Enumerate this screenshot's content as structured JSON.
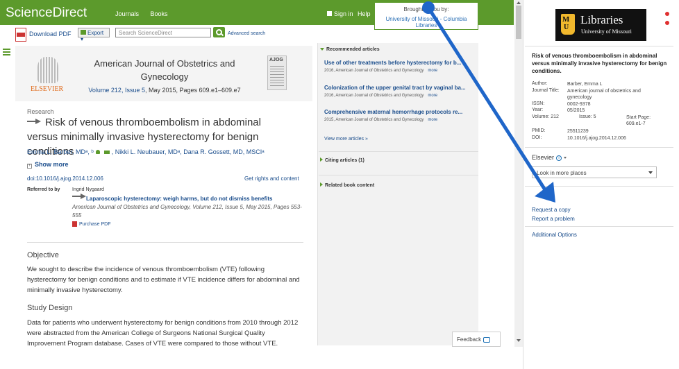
{
  "header": {
    "logo": "ScienceDirect",
    "nav": [
      "Journals",
      "Books"
    ],
    "sign_in": "Sign in",
    "help": "Help",
    "brought_by": "Brought to you by:",
    "institution": "University of Missouri - Columbia Libraries"
  },
  "toolbar": {
    "download_pdf": "Download PDF",
    "export": "Export",
    "search_placeholder": "Search ScienceDirect",
    "advanced_search": "Advanced search"
  },
  "article": {
    "publisher": "ELSEVIER",
    "journal": "American Journal of Obstetrics and Gynecology",
    "volume_link": "Volume 212, Issue 5",
    "volume_rest": ", May 2015, Pages 609.e1–609.e7",
    "cover_label": "AJOG",
    "section": "Research",
    "title": "Risk of venous thromboembolism in abdominal versus minimally invasive hysterectomy for benign conditions",
    "authors": [
      "Emma L. Barber, MDᵃ, ᵇ",
      "Nikki L. Neubauer, MDᵃ",
      "Dana R. Gossett, MD, MSCIᵃ"
    ],
    "show_more": "Show more",
    "doi": "doi:10.1016/j.ajog.2014.12.006",
    "rights": "Get rights and content",
    "referred_label": "Referred to by",
    "referred_name": "Ingrid Nygaard",
    "referred_title": "Laparoscopic hysterectomy: weigh harms, but do not dismiss benefits",
    "referred_cite": "American Journal of Obstetrics and Gynecology, Volume 212, Issue 5, May 2015, Pages 553-555",
    "purchase_pdf": "Purchase PDF",
    "objective_heading": "Objective",
    "objective_text": "We sought to describe the incidence of venous thromboembolism (VTE) following hysterectomy for benign conditions and to estimate if VTE incidence differs for abdominal and minimally invasive hysterectomy.",
    "study_heading": "Study Design",
    "study_text": "Data for patients who underwent hysterectomy for benign conditions from 2010 through 2012 were abstracted from the American College of Surgeons National Surgical Quality Improvement Program database. Cases of VTE were compared to those without VTE."
  },
  "sidebar_middle": {
    "recommended_heading": "Recommended articles",
    "recommended": [
      {
        "title": "Use of other treatments before hysterectomy for b...",
        "meta": "2016, American Journal of Obstetrics and Gynecology",
        "more": "more"
      },
      {
        "title": "Colonization of the upper genital tract by vaginal ba...",
        "meta": "2016, American Journal of Obstetrics and Gynecology",
        "more": "more"
      },
      {
        "title": "Comprehensive maternal hemorrhage protocols re...",
        "meta": "2015, American Journal of Obstetrics and Gynecology",
        "more": "more"
      }
    ],
    "view_more": "View more articles »",
    "citing": "Citing articles (1)",
    "related": "Related book content",
    "feedback": "Feedback"
  },
  "library_panel": {
    "lib_name": "Libraries",
    "lib_sub": "University of Missouri",
    "title": "Risk of venous thromboembolism in abdominal versus minimally invasive hysterectomy for benign conditions.",
    "fields": {
      "author_label": "Author:",
      "author": "Barber, Emma L",
      "journal_label": "Journal Title:",
      "journal": "American journal of obstetrics and gynecology",
      "issn_label": "ISSN:",
      "issn": "0002-9378",
      "year_label": "Year:",
      "year": "05/2015",
      "volume_label": "Volume: 212",
      "issue": "Issue: 5",
      "start_page": "Start Page: 609.e1-7",
      "pmid_label": "PMID:",
      "pmid": "25511239",
      "doi_label": "DOI:",
      "doi": "10.1016/j.ajog.2014.12.006"
    },
    "provider": "Elsevier",
    "look_more": "Look in more places",
    "request_copy": "Request a copy",
    "report_problem": "Report a problem",
    "additional_options": "Additional Options"
  },
  "colors": {
    "brand_green": "#5c9a2c",
    "link_blue": "#1a4d8c",
    "annotation_arrow": "#1f66c9"
  }
}
